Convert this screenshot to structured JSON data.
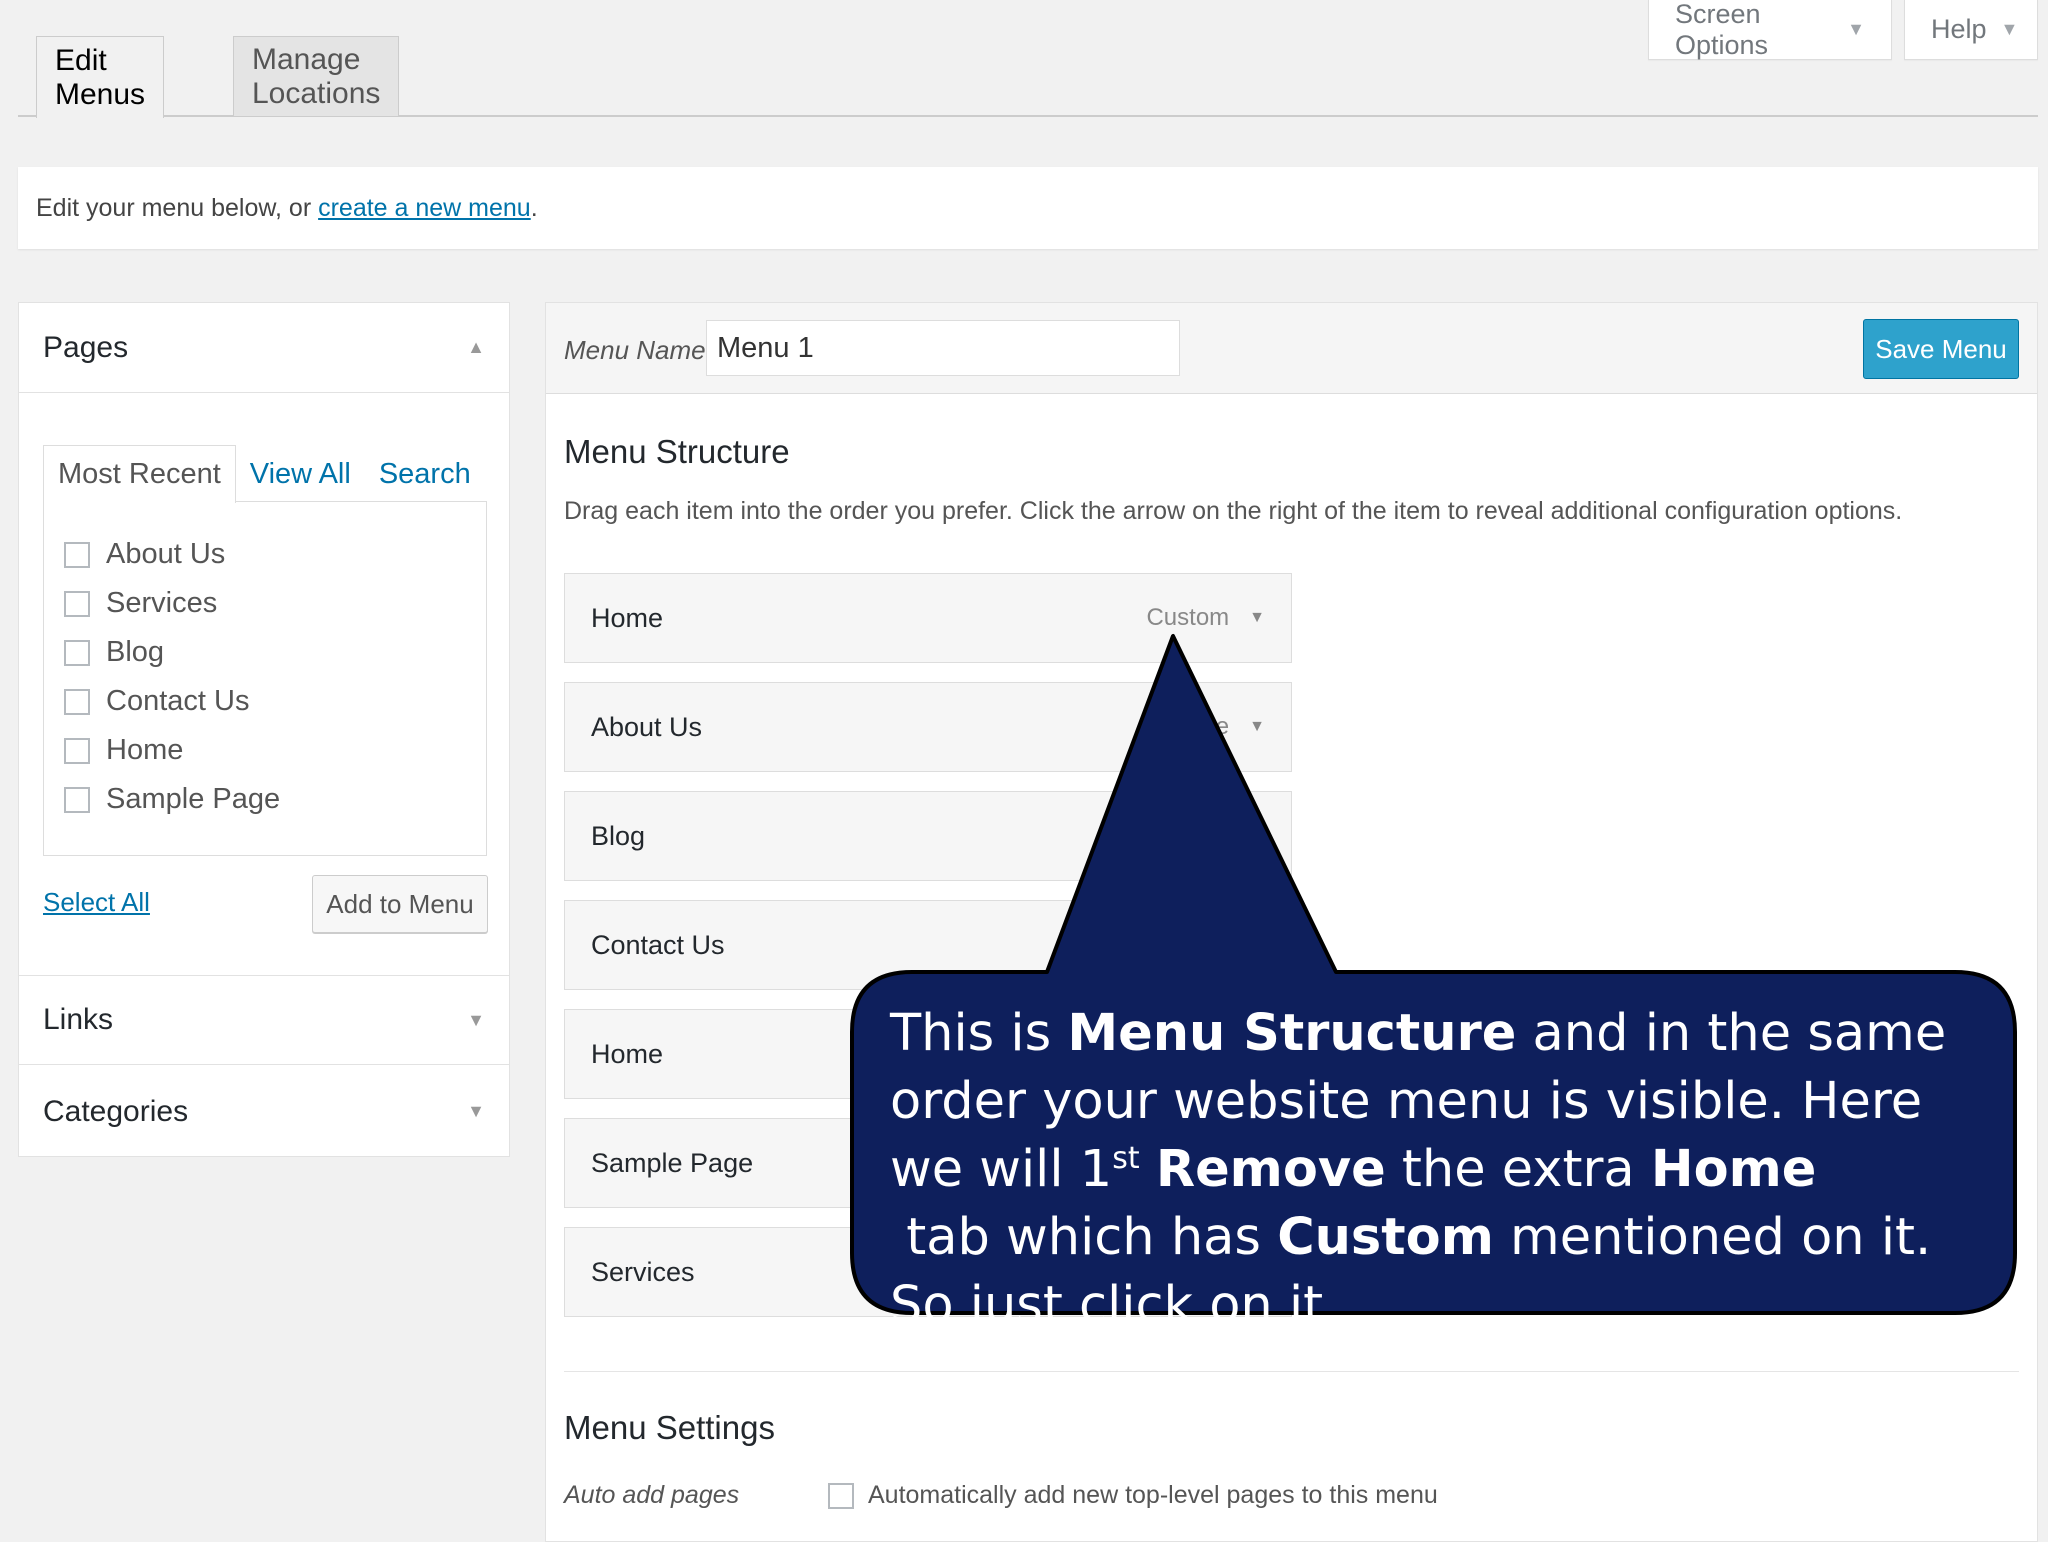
{
  "screen_meta": {
    "screen_options": "Screen Options",
    "help": "Help"
  },
  "nav_tabs": {
    "edit_menus": "Edit Menus",
    "manage_locations": "Manage Locations"
  },
  "notice": {
    "prefix": "Edit your menu below, or ",
    "link": "create a new menu",
    "suffix": "."
  },
  "left": {
    "pages_title": "Pages",
    "tabs": [
      "Most Recent",
      "View All",
      "Search"
    ],
    "pages": [
      "About Us",
      "Services",
      "Blog",
      "Contact Us",
      "Home",
      "Sample Page"
    ],
    "select_all": "Select All",
    "add_to_menu": "Add to Menu",
    "links_title": "Links",
    "categories_title": "Categories"
  },
  "right": {
    "menu_name_label": "Menu Name",
    "menu_name_value": "Menu 1",
    "save_menu": "Save Menu",
    "structure_title": "Menu Structure",
    "structure_desc": "Drag each item into the order you prefer. Click the arrow on the right of the item to reveal additional configuration options.",
    "items": [
      {
        "label": "Home",
        "type": "Custom"
      },
      {
        "label": "About Us",
        "type": "Page"
      },
      {
        "label": "Blog",
        "type": ""
      },
      {
        "label": "Contact Us",
        "type": ""
      },
      {
        "label": "Home",
        "type": ""
      },
      {
        "label": "Sample Page",
        "type": ""
      },
      {
        "label": "Services",
        "type": ""
      }
    ],
    "settings_title": "Menu Settings",
    "auto_add_label": "Auto add pages",
    "auto_add_text": "Automatically add new top-level pages to this menu"
  },
  "callout": {
    "t1": "This is ",
    "b1": "Menu Structure",
    "t2": " and in the same order your website menu is visible. Here we will 1",
    "sup": "st",
    "b2": "Remove",
    "t3": " the extra ",
    "b3": "Home",
    "t4": " tab which has ",
    "b4": "Custom",
    "t5": " mentioned on it. So just click on it."
  },
  "colors": {
    "primary": "#2ea2cc",
    "link": "#0073aa",
    "callout_fill": "#0e1f5c"
  }
}
